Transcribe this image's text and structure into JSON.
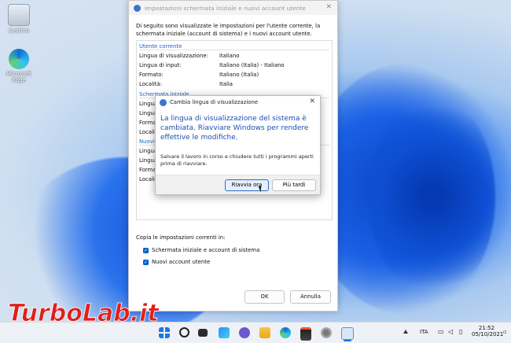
{
  "desktop": {
    "icons": [
      {
        "label": "Cestino",
        "icon": "recycle-bin-icon"
      },
      {
        "label": "Microsoft Edge",
        "icon": "edge-icon"
      }
    ]
  },
  "main_window": {
    "title": "Impostazioni schermata iniziale e nuovi account utente",
    "intro": "Di seguito sono visualizzate le impostazioni per l'utente corrente, la schermata iniziale (account di sistema) e i nuovi account utente.",
    "current_user": {
      "heading": "Utente corrente",
      "rows": [
        {
          "label": "Lingua di visualizzazione:",
          "value": "italiano"
        },
        {
          "label": "Lingua di input:",
          "value": "Italiano (Italia) - Italiano"
        },
        {
          "label": "Formato:",
          "value": "Italiano (Italia)"
        },
        {
          "label": "Località:",
          "value": "Italia"
        }
      ]
    },
    "welcome_screen": {
      "heading": "Schermata iniziale",
      "rows": [
        {
          "label": "Lingua"
        },
        {
          "label": "Lingua"
        },
        {
          "label": "Forma"
        },
        {
          "label": "Locali"
        }
      ]
    },
    "new_users": {
      "heading": "Nuovi",
      "rows": [
        {
          "label": "Lingua"
        },
        {
          "label": "Lingua"
        },
        {
          "label": "Formato:"
        },
        {
          "label": "Località:"
        }
      ]
    },
    "copy_label": "Copia le impostazioni correnti in:",
    "checkboxes": [
      {
        "label": "Schermata iniziale e account di sistema",
        "checked": true
      },
      {
        "label": "Nuovi account utente",
        "checked": true
      }
    ],
    "ok_label": "OK",
    "cancel_label": "Annulla"
  },
  "dialog": {
    "title": "Cambia lingua di visualizzazione",
    "main_text": "La lingua di visualizzazione del sistema è cambiata. Riavviare Windows per rendere effettive le modifiche.",
    "sub_text": "Salvare il lavoro in corso e chiudere tutti i programmi aperti prima di riavviare.",
    "restart_label": "Riavvia ora",
    "later_label": "Più tardi"
  },
  "taskbar": {
    "icons": [
      "start-icon",
      "search-icon",
      "task-view-icon",
      "widgets-icon",
      "chat-icon",
      "file-explorer-icon",
      "edge-icon",
      "store-icon",
      "settings-icon",
      "language-settings-icon"
    ],
    "language": "ITA",
    "time": "21:52",
    "date": "05/10/2021"
  },
  "watermark": {
    "text": "TurboLab.it"
  },
  "colors": {
    "accent": "#0a5fc8",
    "dialog_heading": "#1c4fb0",
    "watermark_red": "#e0201b"
  }
}
